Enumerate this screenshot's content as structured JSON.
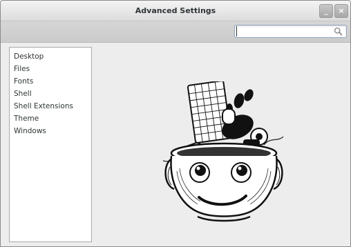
{
  "window": {
    "title": "Advanced Settings",
    "minimize_label": "_",
    "close_label": "×"
  },
  "toolbar": {
    "search": {
      "value": "",
      "placeholder": "",
      "icon": "search-icon"
    }
  },
  "sidebar": {
    "items": [
      {
        "label": "Desktop"
      },
      {
        "label": "Files"
      },
      {
        "label": "Fonts"
      },
      {
        "label": "Shell"
      },
      {
        "label": "Shell Extensions"
      },
      {
        "label": "Theme"
      },
      {
        "label": "Windows"
      }
    ]
  },
  "main": {
    "illustration": "tweak-tool-head-icon"
  },
  "colors": {
    "window_bg": "#ededed",
    "titlebar": "#e6e6e6",
    "toolbar": "#cfcfcf",
    "search_border": "#8aa4c0",
    "text": "#2e3436"
  }
}
